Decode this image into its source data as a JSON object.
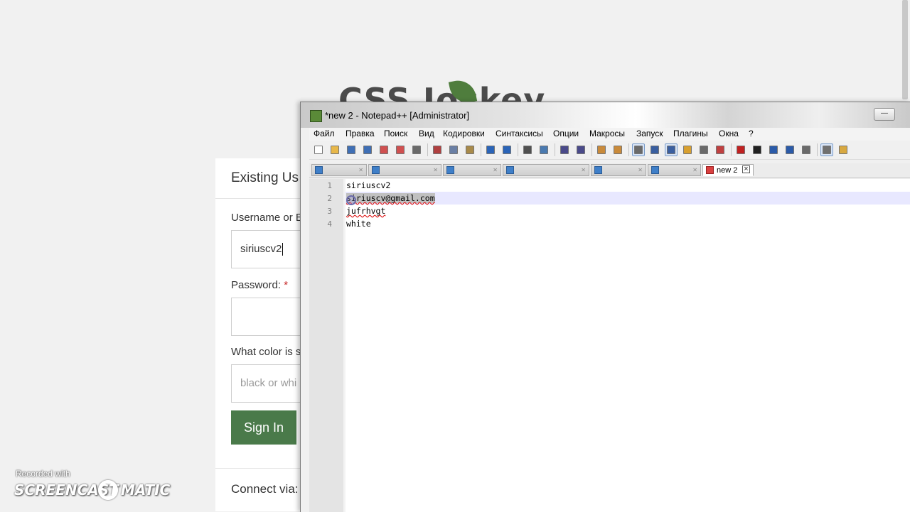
{
  "webpage": {
    "logo_text": "CSS Jockey",
    "login": {
      "section_title": "Existing Us",
      "username_label": "Username or E",
      "username_value": "siriuscv2",
      "password_label": "Password:",
      "password_required": "*",
      "question_label": "What color is s",
      "question_placeholder": "black or whi",
      "sign_in_label": "Sign In",
      "connect_label": "Connect via:"
    }
  },
  "notepad": {
    "title": "*new  2 - Notepad++ [Administrator]",
    "menu": [
      "Файл",
      "Правка",
      "Поиск",
      "Вид",
      "Кодировки",
      "Синтаксисы",
      "Опции",
      "Макросы",
      "Запуск",
      "Плагины",
      "Окна",
      "?"
    ],
    "active_tab": "new  2",
    "inactive_tab_count": 7,
    "toolbar_icons": [
      "new-file-icon",
      "open-file-icon",
      "save-icon",
      "save-all-icon",
      "close-icon",
      "close-all-icon",
      "print-icon",
      "cut-icon",
      "copy-icon",
      "paste-icon",
      "undo-icon",
      "redo-icon",
      "find-icon",
      "replace-icon",
      "zoom-in-icon",
      "zoom-out-icon",
      "sync-vertical-icon",
      "sync-horizontal-icon",
      "word-wrap-icon",
      "show-all-chars-icon",
      "indent-guide-icon",
      "user-lang-icon",
      "doc-map-icon",
      "function-list-icon",
      "record-macro-icon",
      "stop-macro-icon",
      "play-macro-icon",
      "run-macro-multiple-icon",
      "save-macro-icon",
      "spell-check-icon",
      "folder-icon"
    ],
    "lines": [
      {
        "num": "1",
        "text": "siriuscv2"
      },
      {
        "num": "2",
        "text": "siriuscv@gmail.com"
      },
      {
        "num": "3",
        "text": "jufrhvgt"
      },
      {
        "num": "4",
        "text": "white"
      }
    ]
  },
  "watermark": {
    "recorded_with": "Recorded with",
    "brand_left": "SCREENCAST",
    "brand_right": "MATIC"
  },
  "colors": {
    "sign_in_button": "#4a7a4a",
    "required_star": "#c62828",
    "current_line": "#e8e8ff",
    "gutter": "#e4e4e4"
  }
}
